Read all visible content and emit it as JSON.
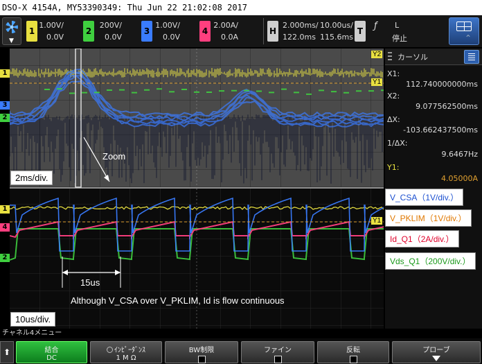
{
  "title": "DSO-X 4154A, MY53390349: Thu Jun 22 21:02:08 2017",
  "channels": [
    {
      "num": "1",
      "scale": "1.00V/",
      "offset": "0.0V",
      "color": "#e8e040"
    },
    {
      "num": "2",
      "scale": "200V/",
      "offset": "0.0V",
      "color": "#3fcf3f"
    },
    {
      "num": "3",
      "scale": "1.00V/",
      "offset": "0.0V",
      "color": "#3a7cff"
    },
    {
      "num": "4",
      "scale": "2.00A/",
      "offset": "0.0A",
      "color": "#ff3f7f"
    }
  ],
  "horizontal": {
    "label": "H",
    "main_scale": "2.000ms/",
    "main_delay": "122.0ms",
    "zoom_scale": "10.00us/",
    "zoom_delay": "115.6ms"
  },
  "trigger": {
    "label": "T",
    "edge": "L",
    "status": "停止"
  },
  "cursor_panel": {
    "title": "カーソル",
    "x1_label": "X1:",
    "x1_value": "112.740000000ms",
    "x2_label": "X2:",
    "x2_value": "9.077562500ms",
    "dx_label": "ΔX:",
    "dx_value": "-103.662437500ms",
    "inv_label": "1/ΔX:",
    "inv_value": "9.6467Hz",
    "y1_label": "Y1:",
    "y1_value": "4.05000A"
  },
  "annotations": {
    "zoom": "Zoom",
    "main_scale": "2ms/div.",
    "zoom_scale": "10us/div.",
    "period": "15us",
    "note": "Although V_CSA over V_PKLIM, Id is flow continuous",
    "legend_csa": "V_CSA（1V/div.）",
    "legend_pklim": "V_PKLIM（1V/div.）",
    "legend_id": "Id_Q1（2A/div.）",
    "legend_vds": "Vds_Q1（200V/div.）",
    "y1_marker": "Y1",
    "y2_marker": "Y2"
  },
  "colors": {
    "ch1": "#e8e040",
    "ch2": "#3fcf3f",
    "ch3": "#3a7cff",
    "ch4": "#ff3f7f",
    "legend_csa": "#1a4fd0",
    "legend_pklim": "#e07800",
    "legend_id": "#e0002a",
    "legend_vds": "#1a9a1a"
  },
  "menu": {
    "title": "チャネル4メニュー",
    "softkeys": [
      {
        "label": "結合",
        "value": "DC"
      },
      {
        "label": "ｲﾝﾋﾟｰﾀﾞﾝｽ",
        "value": "1 M Ω"
      },
      {
        "label": "BW制限",
        "value": ""
      },
      {
        "label": "ファイン",
        "value": ""
      },
      {
        "label": "反転",
        "value": ""
      },
      {
        "label": "プローブ",
        "value": ""
      }
    ]
  }
}
